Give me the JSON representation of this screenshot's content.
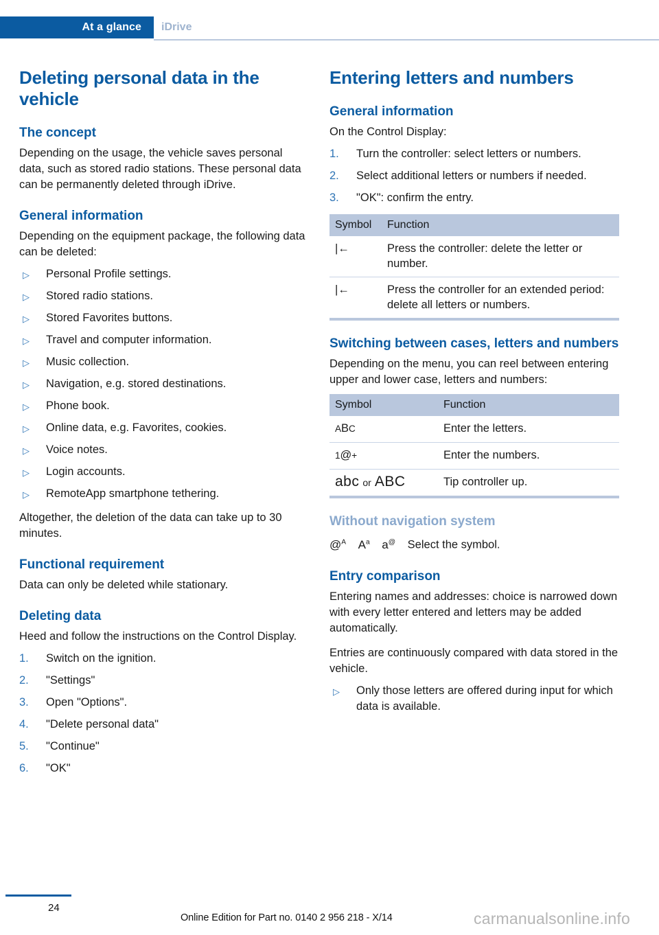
{
  "header": {
    "tab_label": "At a glance",
    "topic_label": "iDrive"
  },
  "left_column": {
    "chapter_title": "Deleting personal data in the vehicle",
    "sections": [
      {
        "heading": "The concept",
        "paragraph": "Depending on the usage, the vehicle saves personal data, such as stored radio stations. These personal data can be permanently deleted through iDrive."
      },
      {
        "heading": "General information",
        "paragraph": "Depending on the equipment package, the following data can be deleted:",
        "bullets": [
          "Personal Profile settings.",
          "Stored radio stations.",
          "Stored Favorites buttons.",
          "Travel and computer information.",
          "Music collection.",
          "Navigation, e.g. stored destinations.",
          "Phone book.",
          "Online data, e.g. Favorites, cookies.",
          "Voice notes.",
          "Login accounts.",
          "RemoteApp smartphone tethering."
        ],
        "closing_paragraph": "Altogether, the deletion of the data can take up to 30 minutes."
      },
      {
        "heading": "Functional requirement",
        "paragraph": "Data can only be deleted while stationary."
      },
      {
        "heading": "Deleting data",
        "paragraph": "Heed and follow the instructions on the Control Display.",
        "steps": [
          {
            "num": "1.",
            "text": "Switch on the ignition."
          },
          {
            "num": "2.",
            "text": "\"Settings\""
          },
          {
            "num": "3.",
            "text": "Open \"Options\"."
          },
          {
            "num": "4.",
            "text": "\"Delete personal data\""
          },
          {
            "num": "5.",
            "text": "\"Continue\""
          },
          {
            "num": "6.",
            "text": "\"OK\""
          }
        ]
      }
    ]
  },
  "right_column": {
    "chapter_title": "Entering letters and numbers",
    "general_information": {
      "heading": "General information",
      "paragraph": "On the Control Display:",
      "steps": [
        {
          "num": "1.",
          "text": "Turn the controller: select letters or numbers."
        },
        {
          "num": "2.",
          "text": "Select additional letters or numbers if needed."
        },
        {
          "num": "3.",
          "text": "\"OK\": confirm the entry."
        }
      ]
    },
    "delete_table": {
      "columns": [
        "Symbol",
        "Function"
      ],
      "rows": [
        {
          "symbol": "|←",
          "function": "Press the controller: delete the letter or number."
        },
        {
          "symbol": "|←",
          "function": "Press the controller for an extended period: delete all letters or numbers."
        }
      ]
    },
    "switching": {
      "heading": "Switching between cases, letters and numbers",
      "paragraph": "Depending on the menu, you can reel between entering upper and lower case, letters and numbers:",
      "table": {
        "columns": [
          "Symbol",
          "Function"
        ],
        "rows": [
          {
            "symbol_parts": {
              "a": "A",
              "b": "B",
              "c": "C"
            },
            "symbol_text": "ABC",
            "function": "Enter the letters."
          },
          {
            "symbol_parts": {
              "a": "1",
              "b": "@",
              "c": "+"
            },
            "symbol_text": "1@+",
            "function": "Enter the numbers."
          },
          {
            "symbol_parts": {
              "a": "abc",
              "b": "or",
              "c": "ABC"
            },
            "symbol_text": "abc or ABC",
            "function": "Tip controller up."
          }
        ]
      }
    },
    "without_nav": {
      "heading": "Without navigation system",
      "symbols": [
        {
          "base": "@",
          "sup": "A"
        },
        {
          "base": "A",
          "sup": "a"
        },
        {
          "base": "a",
          "sup": "@"
        }
      ],
      "text": "Select the symbol."
    },
    "entry_comparison": {
      "heading": "Entry comparison",
      "paragraph1": "Entering names and addresses: choice is narrowed down with every letter entered and letters may be added automatically.",
      "paragraph2": "Entries are continuously compared with data stored in the vehicle.",
      "bullets": [
        "Only those letters are offered during input for which data is available."
      ]
    }
  },
  "footer": {
    "page_number": "24",
    "edition": "Online Edition for Part no. 0140 2 956 218 - X/14",
    "watermark": "carmanualsonline.info"
  }
}
